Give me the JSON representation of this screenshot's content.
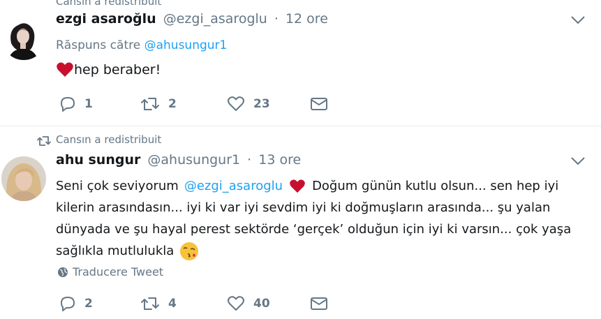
{
  "tweets": [
    {
      "retweet_context": "Cansın a redistribuit",
      "name": "ezgi asaroğlu",
      "handle": "@ezgi_asaroglu",
      "separator": "·",
      "time": "12 ore",
      "reply_label": "Răspuns către",
      "reply_handle": "@ahusungur1",
      "text": "hep beraber!",
      "text_emoji": "heart-emoji",
      "actions": {
        "replies": "1",
        "retweets": "2",
        "likes": "23"
      }
    },
    {
      "retweet_context": "Cansın a redistribuit",
      "name": "ahu sungur",
      "handle": "@ahusungur1",
      "separator": "·",
      "time": "13 ore",
      "text_lines": {
        "l1_a": "Seni çok seviyorum",
        "l1_mention": "@ezgi_asaroglu",
        "l1_b": "Doğum günün kutlu olsun... sen hep iyi",
        "l2": "kilerin arasındasın... iyi ki var iyi sevdim iyi ki doğmuşların arasında... şu yalan",
        "l3": "dünyada ve şu hayal perest sektörde ‘gerçek’ olduğun için iyi ki varsın... çok yaşa",
        "l4": "sağlıkla mutlulukla"
      },
      "translate_label": "Traducere Tweet",
      "actions": {
        "replies": "2",
        "retweets": "4",
        "likes": "40"
      }
    }
  ],
  "colors": {
    "accent": "#1da1f2",
    "muted": "#657786",
    "heart": "#e0245e",
    "divider": "#e6ecf0"
  }
}
